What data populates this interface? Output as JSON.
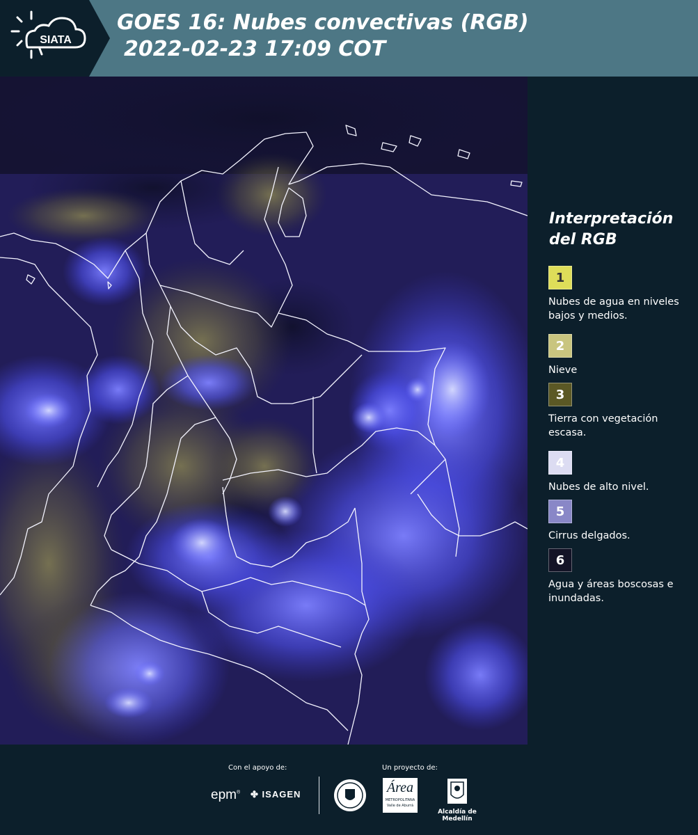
{
  "header": {
    "logo_text": "SIATA",
    "title_line1": "GOES 16: Nubes convectivas (RGB)",
    "title_line2": "2022-02-23 17:09 COT"
  },
  "legend": {
    "title_line1": "Interpretación",
    "title_line2": "del RGB",
    "items": [
      {
        "num": "1",
        "color": "#dedd59",
        "text_color": "#333333",
        "label": "Nubes de agua en niveles bajos y medios."
      },
      {
        "num": "2",
        "color": "#c9c57f",
        "text_color": "#ffffff",
        "label": "Nieve"
      },
      {
        "num": "3",
        "color": "#5b5825",
        "text_color": "#ffffff",
        "label": "Tierra con vegetación escasa."
      },
      {
        "num": "4",
        "color": "#dcdcf2",
        "text_color": "#ffffff",
        "label": "Nubes de alto nivel."
      },
      {
        "num": "5",
        "color": "#8987c7",
        "text_color": "#ffffff",
        "label": "Cirrus delgados."
      },
      {
        "num": "6",
        "color": "#131326",
        "text_color": "#ffffff",
        "label": "Agua y áreas boscosas e inundadas."
      }
    ]
  },
  "footer": {
    "support_label": "Con el apoyo de:",
    "project_label": "Un proyecto de:",
    "sponsor_epm": "epm",
    "sponsor_isagen": "ISAGEN",
    "sponsor_area_main": "Área",
    "sponsor_area_sub1": "METROPOLITANA",
    "sponsor_area_sub2": "Valle de Aburrá",
    "sponsor_alcaldia": "Alcaldía de Medellín"
  },
  "colors": {
    "header_bg": "#4d7785",
    "logo_bg": "#0c1f2b",
    "footer_bg": "#0c1f2b",
    "map_base": "#201b55",
    "convective_cloud": "#5a5cff"
  }
}
